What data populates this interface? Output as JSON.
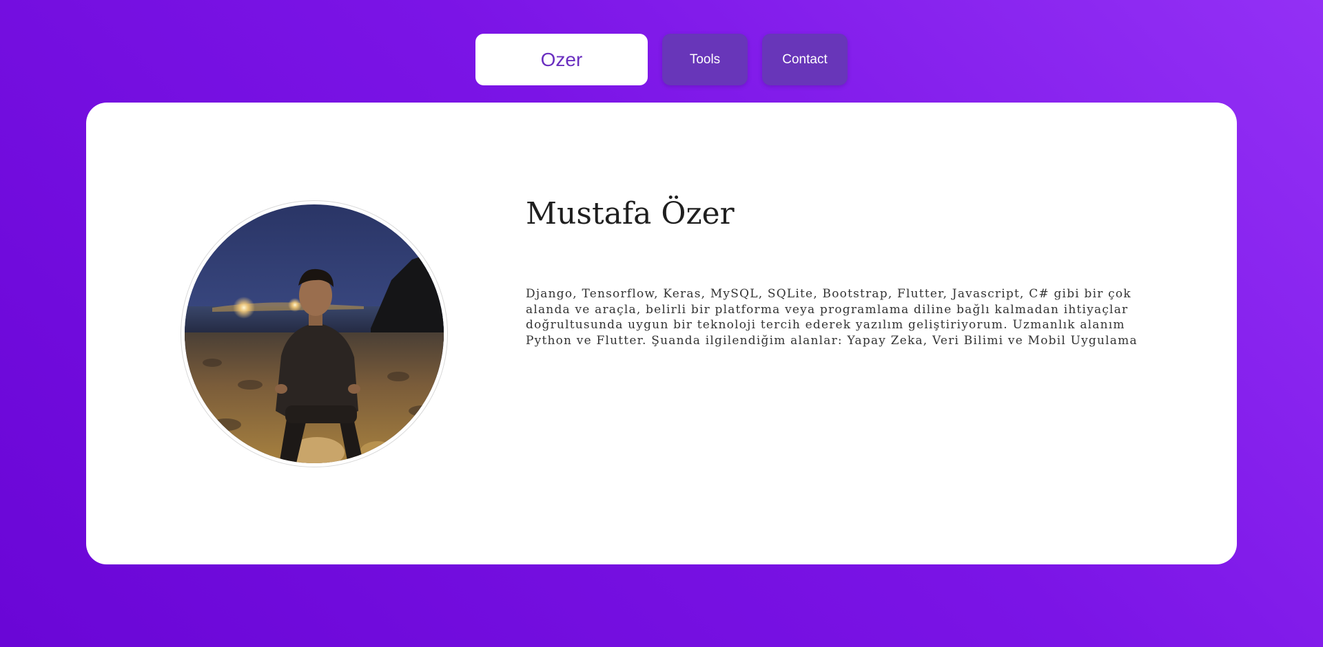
{
  "nav": {
    "brand_label": "Ozer",
    "items": [
      {
        "label": "Tools"
      },
      {
        "label": "Contact"
      }
    ]
  },
  "profile": {
    "name": "Mustafa Özer",
    "bio": "Django, Tensorflow, Keras, MySQL, SQLite, Bootstrap, Flutter, Javascript, C# gibi bir çok alanda ve araçla, belirli bir platforma veya programlama diline bağlı kalmadan ihtiyaçlar doğrultusunda uygun bir teknoloji tercih ederek yazılım geliştiriyorum. Uzmanlık alanım Python ve Flutter. Şuanda ilgilendiğim alanlar: Yapay Zeka, Veri Bilimi ve Mobil Uygulama"
  },
  "colors": {
    "background_gradient": [
      "#9330f5",
      "#6a06d6"
    ],
    "nav_pill": "#6836b9",
    "brand_text": "#6a2fc0",
    "card": "#ffffff"
  }
}
